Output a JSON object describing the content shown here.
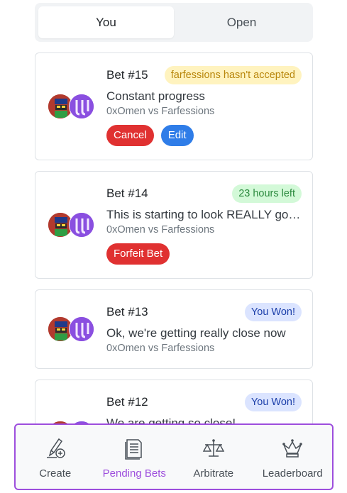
{
  "tabs": [
    {
      "label": "You",
      "active": true
    },
    {
      "label": "Open",
      "active": false
    }
  ],
  "bets": [
    {
      "number": "Bet #15",
      "badge": "farfessions hasn't accepted",
      "badge_style": "warn",
      "title": "Constant progress",
      "players": "0xOmen vs Farfessions",
      "actions": [
        "Cancel",
        "Edit"
      ]
    },
    {
      "number": "Bet #14",
      "badge": "23 hours left",
      "badge_style": "ok",
      "title": "This is starting to look REALLY good",
      "players": "0xOmen vs Farfessions",
      "actions": [
        "Forfeit Bet"
      ]
    },
    {
      "number": "Bet #13",
      "badge": "You Won!",
      "badge_style": "won",
      "title": "Ok, we're getting really close now",
      "players": "0xOmen vs Farfessions",
      "actions": []
    },
    {
      "number": "Bet #12",
      "badge": "You Won!",
      "badge_style": "won",
      "title": "We are getting so close!",
      "players": "",
      "actions": []
    }
  ],
  "nav": [
    {
      "label": "Create",
      "icon": "pencil-plus-icon",
      "active": false
    },
    {
      "label": "Pending Bets",
      "icon": "document-icon",
      "active": true
    },
    {
      "label": "Arbitrate",
      "icon": "scales-icon",
      "active": false
    },
    {
      "label": "Leaderboard",
      "icon": "crown-icon",
      "active": false
    }
  ],
  "colors": {
    "accent": "#9d4edd",
    "danger": "#e03131",
    "primary": "#2f7de8"
  }
}
